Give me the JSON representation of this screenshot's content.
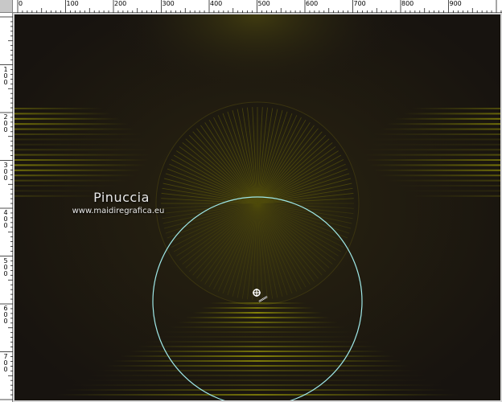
{
  "ruler": {
    "top_labels": [
      "0",
      "100",
      "200",
      "300",
      "400",
      "500",
      "600",
      "700",
      "800",
      "900"
    ],
    "left_labels": [
      "100",
      "200",
      "300",
      "400",
      "500",
      "600",
      "700"
    ],
    "bg_color": "#ffffff",
    "corner_color": "#c8c8c8"
  },
  "canvas": {
    "bg_color": "#1c1712",
    "accent_color": "#6b6a06",
    "selection_color": "#9fe8e8"
  },
  "watermark": {
    "name": "Pinuccia",
    "site": "www.maidiregrafica.eu"
  },
  "cursor": {
    "icon": "selection-move-icon"
  }
}
